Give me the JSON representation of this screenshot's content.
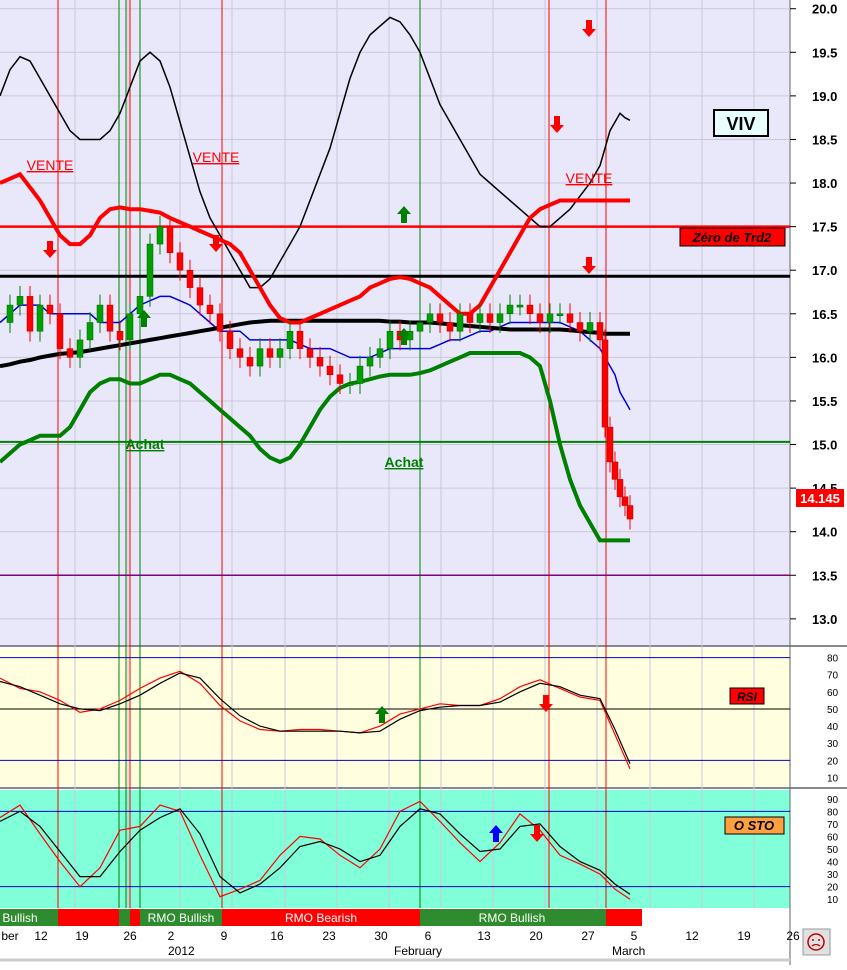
{
  "symbol": "VIV",
  "zero_label": "Zéro de Trd2",
  "last_price": "14.145",
  "signals": [
    {
      "text": "VENTE",
      "kind": "sell"
    },
    {
      "text": "VENTE",
      "kind": "sell"
    },
    {
      "text": "VENTE",
      "kind": "sell"
    },
    {
      "text": "Achat",
      "kind": "buy"
    },
    {
      "text": "Achat",
      "kind": "buy"
    }
  ],
  "price_axis_ticks": [
    "20.0",
    "19.5",
    "19.0",
    "18.5",
    "18.0",
    "17.5",
    "17.0",
    "16.5",
    "16.0",
    "15.5",
    "15.0",
    "14.5",
    "14.0",
    "13.5",
    "13.0"
  ],
  "rsi_label": "RSI",
  "rsi_axis_ticks": [
    "80",
    "70",
    "60",
    "50",
    "40",
    "30",
    "20",
    "10"
  ],
  "sto_label": "O STO",
  "sto_axis_ticks": [
    "90",
    "80",
    "70",
    "60",
    "50",
    "40",
    "30",
    "20",
    "10"
  ],
  "rmo_bar": [
    "Bullish",
    "RMO Bullish",
    "RMO Bearish",
    "RMO Bullish"
  ],
  "date_axis": [
    "ber",
    "12",
    "19",
    "26",
    "2",
    "9",
    "16",
    "23",
    "30",
    "6",
    "13",
    "20",
    "27",
    "5",
    "12",
    "19",
    "26"
  ],
  "date_axis_months": [
    "2012",
    "February",
    "March"
  ],
  "colors": {
    "sell": "#ff0000",
    "buy": "#008000",
    "bg_price": "#e8e8fa",
    "bg_rsi": "#ffffe0",
    "bg_sto": "#80ffd8"
  },
  "chart_data": [
    {
      "type": "line",
      "title": "VIV",
      "ylim": [
        12.7,
        20.1
      ],
      "x": [
        0,
        10,
        20,
        30,
        40,
        50,
        60,
        70,
        80,
        90,
        100,
        110,
        120,
        130,
        140,
        150,
        160,
        170,
        180,
        190,
        200,
        210,
        220,
        230,
        240,
        250,
        260,
        270,
        280,
        290,
        300,
        310,
        320,
        330,
        340,
        350,
        360,
        370,
        380,
        390,
        400,
        410,
        420,
        430,
        440,
        450,
        460,
        470,
        480,
        490,
        500,
        510,
        520,
        530,
        540,
        550,
        560,
        570,
        580,
        590,
        600,
        605,
        610,
        615,
        620,
        625,
        630
      ],
      "series": [
        {
          "values": [
            16.4,
            16.6,
            16.7,
            16.3,
            16.6,
            16.5,
            16.1,
            16.0,
            16.2,
            16.4,
            16.6,
            16.3,
            16.2,
            16.5,
            16.7,
            17.3,
            17.5,
            17.2,
            17.0,
            16.8,
            16.6,
            16.5,
            16.3,
            16.1,
            16.0,
            15.9,
            16.1,
            16.0,
            16.1,
            16.3,
            16.1,
            16.0,
            15.9,
            15.8,
            15.7,
            15.7,
            15.9,
            16.0,
            16.1,
            16.3,
            16.2,
            16.3,
            16.4,
            16.5,
            16.4,
            16.3,
            16.5,
            16.4,
            16.5,
            16.4,
            16.5,
            16.6,
            16.6,
            16.5,
            16.4,
            16.5,
            16.5,
            16.4,
            16.3,
            16.4,
            16.2,
            15.2,
            14.8,
            14.6,
            14.4,
            14.3,
            14.145
          ]
        },
        {
          "values": [
            16.4,
            16.5,
            16.6,
            16.6,
            16.6,
            16.5,
            16.5,
            16.5,
            16.5,
            16.5,
            16.4,
            16.4,
            16.4,
            16.5,
            16.6,
            16.65,
            16.7,
            16.7,
            16.65,
            16.6,
            16.5,
            16.4,
            16.3,
            16.3,
            16.3,
            16.2,
            16.2,
            16.2,
            16.2,
            16.2,
            16.15,
            16.1,
            16.1,
            16.1,
            16.05,
            16.0,
            16.0,
            16.0,
            16.05,
            16.1,
            16.1,
            16.1,
            16.1,
            16.1,
            16.15,
            16.2,
            16.2,
            16.25,
            16.3,
            16.3,
            16.35,
            16.4,
            16.4,
            16.4,
            16.4,
            16.4,
            16.4,
            16.35,
            16.3,
            16.2,
            16.1,
            16.0,
            15.9,
            15.8,
            15.6,
            15.5,
            15.4
          ]
        },
        {
          "values": [
            15.9,
            15.92,
            15.95,
            15.97,
            16.0,
            16.02,
            16.04,
            16.05,
            16.06,
            16.08,
            16.1,
            16.12,
            16.14,
            16.16,
            16.18,
            16.2,
            16.22,
            16.24,
            16.26,
            16.28,
            16.3,
            16.32,
            16.34,
            16.36,
            16.38,
            16.4,
            16.41,
            16.42,
            16.42,
            16.42,
            16.42,
            16.42,
            16.42,
            16.42,
            16.42,
            16.42,
            16.42,
            16.42,
            16.42,
            16.41,
            16.41,
            16.4,
            16.4,
            16.4,
            16.39,
            16.38,
            16.37,
            16.36,
            16.35,
            16.34,
            16.33,
            16.32,
            16.32,
            16.32,
            16.32,
            16.32,
            16.32,
            16.31,
            16.3,
            16.29,
            16.28,
            16.27,
            16.27,
            16.27,
            16.27,
            16.27,
            16.27
          ]
        },
        {
          "values": [
            19.0,
            19.3,
            19.45,
            19.4,
            19.2,
            19.0,
            18.8,
            18.6,
            18.5,
            18.5,
            18.5,
            18.6,
            18.8,
            19.1,
            19.4,
            19.5,
            19.4,
            19.1,
            18.7,
            18.3,
            17.9,
            17.6,
            17.4,
            17.2,
            17.0,
            16.8,
            16.8,
            16.9,
            17.1,
            17.3,
            17.5,
            17.8,
            18.1,
            18.4,
            18.8,
            19.2,
            19.5,
            19.7,
            19.8,
            19.9,
            19.85,
            19.7,
            19.5,
            19.2,
            18.9,
            18.7,
            18.5,
            18.3,
            18.1,
            18.0,
            17.9,
            17.8,
            17.7,
            17.6,
            17.5,
            17.5,
            17.6,
            17.7,
            17.85,
            18.0,
            18.2,
            18.4,
            18.6,
            18.7,
            18.8,
            18.75,
            18.72
          ]
        },
        {
          "values": [
            18.0,
            18.05,
            18.1,
            17.95,
            17.8,
            17.6,
            17.4,
            17.3,
            17.3,
            17.4,
            17.6,
            17.7,
            17.72,
            17.7,
            17.7,
            17.68,
            17.66,
            17.6,
            17.55,
            17.5,
            17.45,
            17.4,
            17.35,
            17.3,
            17.2,
            17.0,
            16.8,
            16.6,
            16.45,
            16.4,
            16.4,
            16.45,
            16.5,
            16.55,
            16.6,
            16.65,
            16.7,
            16.8,
            16.85,
            16.9,
            16.92,
            16.9,
            16.85,
            16.8,
            16.7,
            16.6,
            16.5,
            16.5,
            16.6,
            16.8,
            17.0,
            17.2,
            17.4,
            17.6,
            17.7,
            17.75,
            17.8,
            17.8,
            17.8,
            17.8,
            17.8,
            17.8,
            17.8,
            17.8,
            17.8,
            17.8,
            17.8
          ]
        },
        {
          "values": [
            14.8,
            14.9,
            15.0,
            15.05,
            15.1,
            15.1,
            15.1,
            15.2,
            15.4,
            15.6,
            15.7,
            15.75,
            15.75,
            15.7,
            15.7,
            15.75,
            15.8,
            15.8,
            15.75,
            15.7,
            15.6,
            15.5,
            15.4,
            15.3,
            15.2,
            15.1,
            14.95,
            14.85,
            14.8,
            14.85,
            15.0,
            15.2,
            15.4,
            15.55,
            15.65,
            15.7,
            15.72,
            15.75,
            15.78,
            15.8,
            15.8,
            15.8,
            15.82,
            15.85,
            15.9,
            15.95,
            16.0,
            16.05,
            16.05,
            16.05,
            16.05,
            16.05,
            16.05,
            16.0,
            15.9,
            15.5,
            15.0,
            14.6,
            14.3,
            14.1,
            13.9,
            13.9,
            13.9,
            13.9,
            13.9,
            13.9,
            13.9
          ]
        }
      ],
      "hlines": [
        17.5,
        16.93,
        15.03,
        13.5
      ],
      "grid": true
    },
    {
      "type": "line",
      "title": "RSI",
      "ylim": [
        5,
        85
      ],
      "x": [
        0,
        20,
        40,
        60,
        80,
        100,
        120,
        140,
        160,
        180,
        200,
        220,
        240,
        260,
        280,
        300,
        320,
        340,
        360,
        380,
        400,
        420,
        440,
        460,
        480,
        500,
        520,
        540,
        560,
        580,
        600,
        615,
        630
      ],
      "series": [
        {
          "values": [
            68,
            62,
            60,
            55,
            48,
            50,
            55,
            62,
            68,
            72,
            65,
            52,
            43,
            38,
            37,
            38,
            38,
            37,
            36,
            40,
            47,
            50,
            53,
            52,
            52,
            56,
            63,
            67,
            62,
            57,
            55,
            35,
            15
          ]
        },
        {
          "values": [
            66,
            63,
            58,
            53,
            50,
            49,
            53,
            58,
            65,
            71,
            68,
            56,
            46,
            40,
            37,
            37,
            37,
            37,
            36,
            37,
            44,
            49,
            51,
            52,
            52,
            54,
            60,
            65,
            63,
            58,
            56,
            38,
            18
          ]
        }
      ],
      "hlines": [
        80,
        50,
        20
      ]
    },
    {
      "type": "line",
      "title": "O STO",
      "ylim": [
        3,
        97
      ],
      "x": [
        0,
        20,
        40,
        60,
        80,
        100,
        120,
        140,
        160,
        180,
        200,
        220,
        240,
        260,
        280,
        300,
        320,
        340,
        360,
        380,
        400,
        420,
        440,
        460,
        480,
        500,
        520,
        540,
        560,
        580,
        600,
        615,
        630
      ],
      "series": [
        {
          "values": [
            75,
            85,
            62,
            40,
            20,
            35,
            65,
            68,
            85,
            80,
            45,
            12,
            18,
            25,
            45,
            60,
            58,
            45,
            35,
            50,
            80,
            88,
            72,
            55,
            40,
            55,
            78,
            65,
            45,
            38,
            30,
            18,
            10
          ]
        },
        {
          "values": [
            72,
            80,
            68,
            48,
            28,
            28,
            48,
            65,
            75,
            82,
            62,
            28,
            15,
            22,
            35,
            52,
            56,
            50,
            40,
            45,
            68,
            82,
            78,
            62,
            48,
            50,
            68,
            70,
            52,
            40,
            33,
            22,
            14
          ]
        }
      ],
      "hlines": [
        80,
        20
      ]
    }
  ]
}
